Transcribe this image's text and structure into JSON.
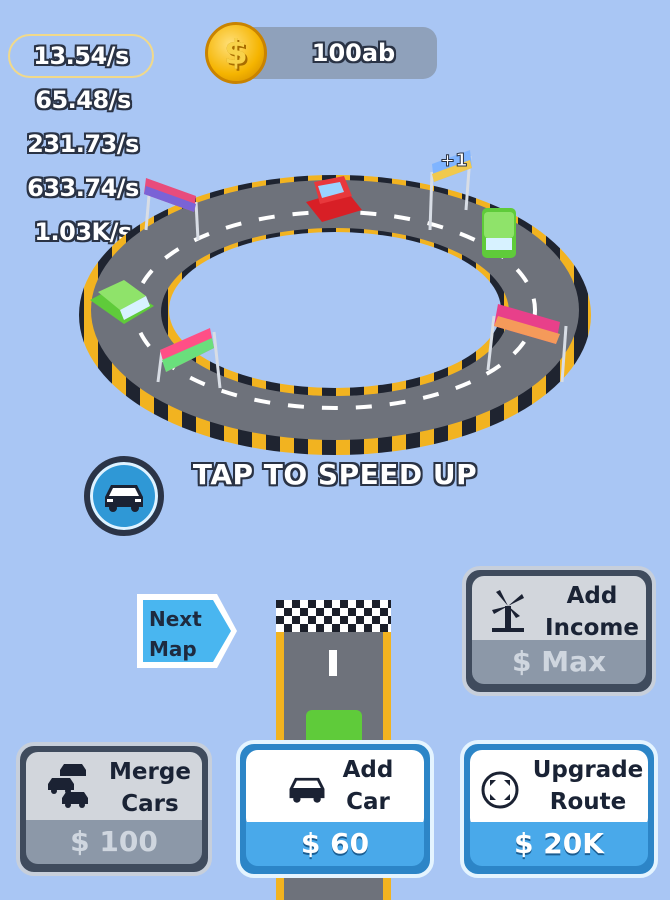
{
  "income_rates": [
    "13.54/s",
    "65.48/s",
    "231.73/s",
    "633.74/s",
    "1.03K/s"
  ],
  "coins": {
    "icon": "dollar-coin-icon",
    "value": "100ab"
  },
  "track_popup": "+1",
  "hint": "TAP TO SPEED UP",
  "next_map": {
    "line1": "Next",
    "line2": "Map"
  },
  "buttons": {
    "add_income": {
      "line1": "Add",
      "line2": "Income",
      "currency": "$",
      "price": "Max",
      "icon": "windmill-icon"
    },
    "merge_cars": {
      "line1": "Merge",
      "line2": "Cars",
      "currency": "$",
      "price": "100",
      "icon": "cars-stack-icon"
    },
    "add_car": {
      "line1": "Add",
      "line2": "Car",
      "currency": "$",
      "price": "60",
      "icon": "car-icon"
    },
    "upgrade_route": {
      "line1": "Upgrade",
      "line2": "Route",
      "currency": "$",
      "price": "20K",
      "icon": "expand-arrows-icon"
    }
  },
  "colors": {
    "background": "#a9c6f4",
    "coin": "#f5b400",
    "button_blue": "#49a9ea",
    "button_gray": "#8c98a8"
  }
}
